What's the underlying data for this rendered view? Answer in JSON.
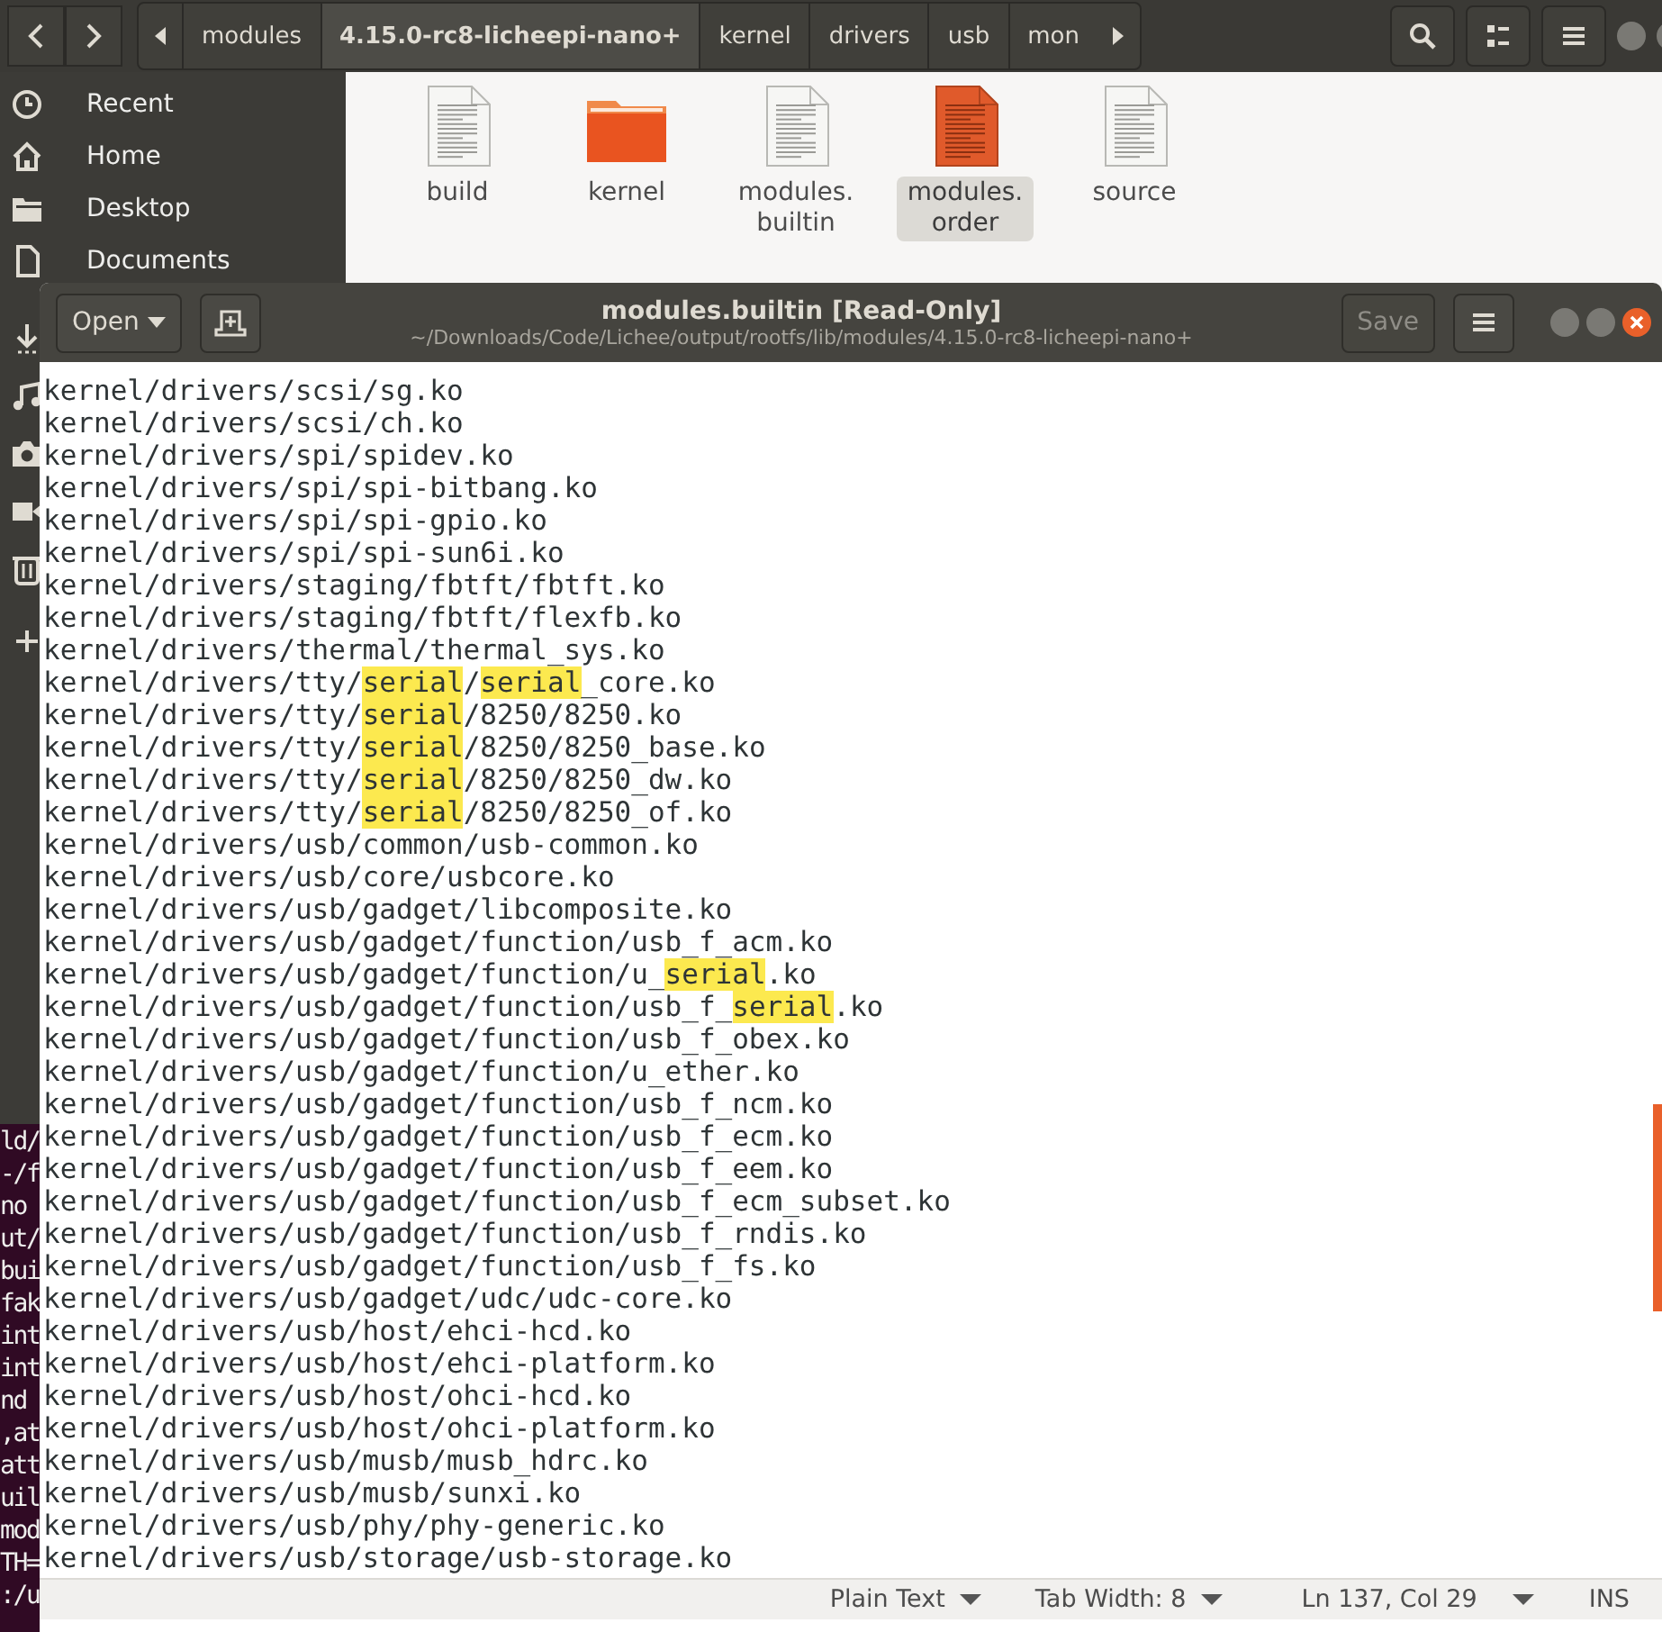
{
  "file_manager": {
    "path_bar": [
      {
        "label": "modules",
        "selected": false
      },
      {
        "label": "4.15.0-rc8-licheepi-nano+",
        "selected": true
      },
      {
        "label": "kernel",
        "selected": false
      },
      {
        "label": "drivers",
        "selected": false
      },
      {
        "label": "usb",
        "selected": false
      },
      {
        "label": "mon",
        "selected": false
      }
    ],
    "sidebar": [
      {
        "kind": "recent",
        "label": "Recent"
      },
      {
        "kind": "home",
        "label": "Home"
      },
      {
        "kind": "folder",
        "label": "Desktop"
      },
      {
        "kind": "document",
        "label": "Documents"
      },
      {
        "kind": "download"
      },
      {
        "kind": "music"
      },
      {
        "kind": "camera"
      },
      {
        "kind": "video"
      },
      {
        "kind": "trash"
      },
      {
        "kind": "add"
      }
    ],
    "files": [
      {
        "name": "build",
        "kind": "document",
        "selected": false
      },
      {
        "name": "kernel",
        "kind": "folder",
        "selected": false
      },
      {
        "name": "modules.builtin",
        "kind": "document",
        "selected": false
      },
      {
        "name": "modules.order",
        "kind": "document",
        "selected": true
      },
      {
        "name": "source",
        "kind": "document",
        "selected": false
      }
    ]
  },
  "terminal": {
    "lines": [
      "ld/",
      "-/f",
      "no",
      "ut/",
      "bui",
      "fak",
      "int",
      "int",
      "nd",
      ",at",
      "att",
      "uil",
      "mod",
      "TH=",
      ":/u"
    ]
  },
  "editor": {
    "title": "modules.builtin [Read-Only]",
    "subtitle": "~/Downloads/Code/Lichee/output/rootfs/lib/modules/4.15.0-rc8-licheepi-nano+",
    "open_button": "Open",
    "save_button": {
      "label": "Save",
      "disabled": true
    },
    "lines": [
      {
        "segments": [
          {
            "text": "kernel/drivers/scsi/sg.ko",
            "highlighted": false
          }
        ]
      },
      {
        "segments": [
          {
            "text": "kernel/drivers/scsi/ch.ko",
            "highlighted": false
          }
        ]
      },
      {
        "segments": [
          {
            "text": "kernel/drivers/spi/spidev.ko",
            "highlighted": false
          }
        ]
      },
      {
        "segments": [
          {
            "text": "kernel/drivers/spi/spi-bitbang.ko",
            "highlighted": false
          }
        ]
      },
      {
        "segments": [
          {
            "text": "kernel/drivers/spi/spi-gpio.ko",
            "highlighted": false
          }
        ]
      },
      {
        "segments": [
          {
            "text": "kernel/drivers/spi/spi-sun6i.ko",
            "highlighted": false
          }
        ]
      },
      {
        "segments": [
          {
            "text": "kernel/drivers/staging/fbtft/fbtft.ko",
            "highlighted": false
          }
        ]
      },
      {
        "segments": [
          {
            "text": "kernel/drivers/staging/fbtft/flexfb.ko",
            "highlighted": false
          }
        ]
      },
      {
        "segments": [
          {
            "text": "kernel/drivers/thermal/thermal_sys.ko",
            "highlighted": false
          }
        ]
      },
      {
        "segments": [
          {
            "text": "kernel/drivers/tty/",
            "highlighted": false
          },
          {
            "text": "serial",
            "highlighted": true
          },
          {
            "text": "/",
            "highlighted": false
          },
          {
            "text": "serial",
            "highlighted": true
          },
          {
            "text": "_core.ko",
            "highlighted": false
          }
        ]
      },
      {
        "segments": [
          {
            "text": "kernel/drivers/tty/",
            "highlighted": false
          },
          {
            "text": "serial",
            "highlighted": true
          },
          {
            "text": "/8250/8250.ko",
            "highlighted": false
          }
        ]
      },
      {
        "segments": [
          {
            "text": "kernel/drivers/tty/",
            "highlighted": false
          },
          {
            "text": "serial",
            "highlighted": true
          },
          {
            "text": "/8250/8250_base.ko",
            "highlighted": false
          }
        ]
      },
      {
        "segments": [
          {
            "text": "kernel/drivers/tty/",
            "highlighted": false
          },
          {
            "text": "serial",
            "highlighted": true
          },
          {
            "text": "/8250/8250_dw.ko",
            "highlighted": false
          }
        ]
      },
      {
        "segments": [
          {
            "text": "kernel/drivers/tty/",
            "highlighted": false
          },
          {
            "text": "serial",
            "highlighted": true
          },
          {
            "text": "/8250/8250_of.ko",
            "highlighted": false
          }
        ]
      },
      {
        "segments": [
          {
            "text": "kernel/drivers/usb/common/usb-common.ko",
            "highlighted": false
          }
        ]
      },
      {
        "segments": [
          {
            "text": "kernel/drivers/usb/core/usbcore.ko",
            "highlighted": false
          }
        ]
      },
      {
        "segments": [
          {
            "text": "kernel/drivers/usb/gadget/libcomposite.ko",
            "highlighted": false
          }
        ]
      },
      {
        "segments": [
          {
            "text": "kernel/drivers/usb/gadget/function/usb_f_acm.ko",
            "highlighted": false
          }
        ]
      },
      {
        "segments": [
          {
            "text": "kernel/drivers/usb/gadget/function/u_",
            "highlighted": false
          },
          {
            "text": "serial",
            "highlighted": true
          },
          {
            "text": ".ko",
            "highlighted": false
          }
        ]
      },
      {
        "segments": [
          {
            "text": "kernel/drivers/usb/gadget/function/usb_f_",
            "highlighted": false
          },
          {
            "text": "serial",
            "highlighted": true
          },
          {
            "text": ".ko",
            "highlighted": false
          }
        ]
      },
      {
        "segments": [
          {
            "text": "kernel/drivers/usb/gadget/function/usb_f_obex.ko",
            "highlighted": false
          }
        ]
      },
      {
        "segments": [
          {
            "text": "kernel/drivers/usb/gadget/function/u_ether.ko",
            "highlighted": false
          }
        ]
      },
      {
        "segments": [
          {
            "text": "kernel/drivers/usb/gadget/function/usb_f_ncm.ko",
            "highlighted": false
          }
        ]
      },
      {
        "segments": [
          {
            "text": "kernel/drivers/usb/gadget/function/usb_f_ecm.ko",
            "highlighted": false
          }
        ]
      },
      {
        "segments": [
          {
            "text": "kernel/drivers/usb/gadget/function/usb_f_eem.ko",
            "highlighted": false
          }
        ]
      },
      {
        "segments": [
          {
            "text": "kernel/drivers/usb/gadget/function/usb_f_ecm_subset.ko",
            "highlighted": false
          }
        ]
      },
      {
        "segments": [
          {
            "text": "kernel/drivers/usb/gadget/function/usb_f_rndis.ko",
            "highlighted": false
          }
        ]
      },
      {
        "segments": [
          {
            "text": "kernel/drivers/usb/gadget/function/usb_f_fs.ko",
            "highlighted": false
          }
        ]
      },
      {
        "segments": [
          {
            "text": "kernel/drivers/usb/gadget/udc/udc-core.ko",
            "highlighted": false
          }
        ]
      },
      {
        "segments": [
          {
            "text": "kernel/drivers/usb/host/ehci-hcd.ko",
            "highlighted": false
          }
        ]
      },
      {
        "segments": [
          {
            "text": "kernel/drivers/usb/host/ehci-platform.ko",
            "highlighted": false
          }
        ]
      },
      {
        "segments": [
          {
            "text": "kernel/drivers/usb/host/ohci-hcd.ko",
            "highlighted": false
          }
        ]
      },
      {
        "segments": [
          {
            "text": "kernel/drivers/usb/host/ohci-platform.ko",
            "highlighted": false
          }
        ]
      },
      {
        "segments": [
          {
            "text": "kernel/drivers/usb/musb/musb_hdrc.ko",
            "highlighted": false
          }
        ]
      },
      {
        "segments": [
          {
            "text": "kernel/drivers/usb/musb/sunxi.ko",
            "highlighted": false
          }
        ]
      },
      {
        "segments": [
          {
            "text": "kernel/drivers/usb/phy/phy-generic.ko",
            "highlighted": false
          }
        ]
      },
      {
        "segments": [
          {
            "text": "kernel/drivers/usb/storage/usb-storage.ko",
            "highlighted": false
          }
        ]
      }
    ],
    "status_bar": {
      "language": "Plain Text",
      "tab_width": "Tab Width: 8",
      "position": "Ln 137, Col 29",
      "mode": "INS"
    }
  }
}
